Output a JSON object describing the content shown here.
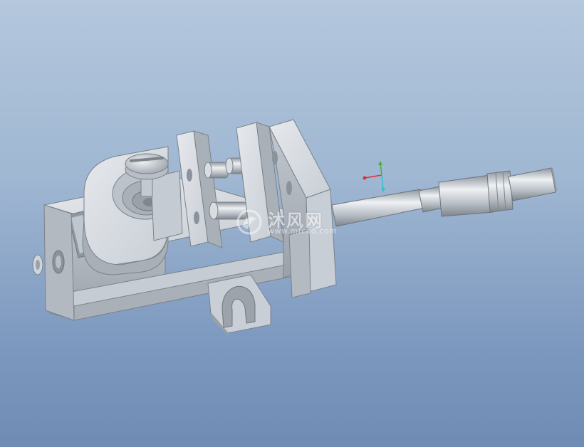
{
  "watermark": {
    "title": "沐风网",
    "url": "www.mfcad.com"
  },
  "colors": {
    "background_top": "#b4c7dd",
    "background_bottom": "#6f8bb4",
    "metal_light": "#dfe3e8",
    "metal_mid": "#b9c0c8",
    "metal_dark": "#8c949d",
    "axis_x": "#e03030",
    "axis_y": "#40b040",
    "axis_z": "#30c0d0"
  },
  "icons": {
    "triad": "coordinate-triad-icon",
    "logo": "mfcad-logo-icon"
  }
}
